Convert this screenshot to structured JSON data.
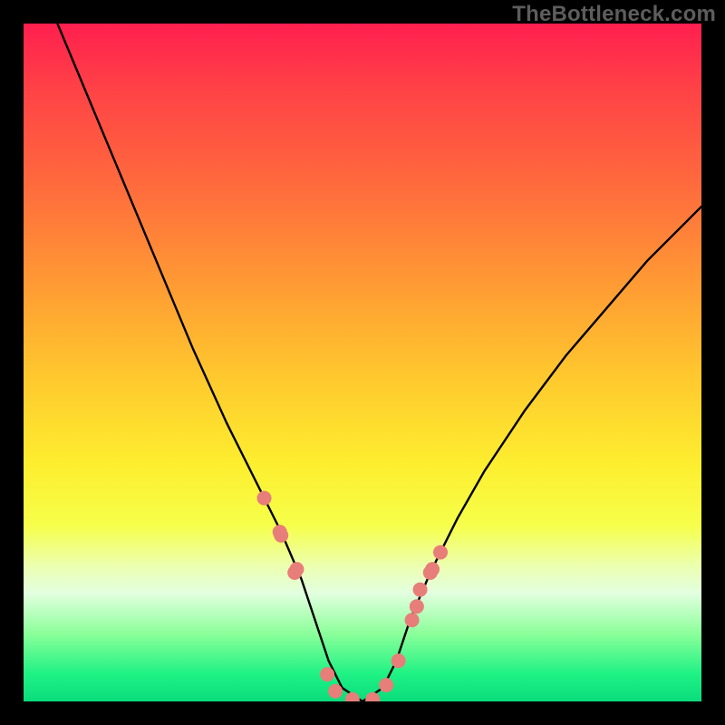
{
  "watermark": "TheBottleneck.com",
  "chart_data": {
    "type": "line",
    "title": "",
    "xlabel": "",
    "ylabel": "",
    "xlim": [
      0,
      100
    ],
    "ylim": [
      0,
      100
    ],
    "series": [
      {
        "name": "curve",
        "x": [
          5,
          10,
          15,
          20,
          25,
          30,
          35,
          38,
          41,
          43,
          45,
          47,
          50,
          53,
          55,
          57,
          60,
          64,
          68,
          74,
          80,
          86,
          92,
          98,
          100
        ],
        "y": [
          100,
          88,
          76,
          64,
          52,
          41,
          31,
          25,
          18,
          12,
          6,
          2,
          0,
          2,
          6,
          12,
          19,
          27,
          34,
          43,
          51,
          58,
          65,
          71,
          73
        ]
      }
    ],
    "markers": {
      "name": "dots",
      "x": [
        35.5,
        37.8,
        38.0,
        40.0,
        40.3,
        44.8,
        46.0,
        48.5,
        51.5,
        53.5,
        55.3,
        57.3,
        58.0,
        58.5,
        60.0,
        60.3,
        61.5
      ],
      "y": [
        30.0,
        25.0,
        24.5,
        19.0,
        19.5,
        4.0,
        1.5,
        0.3,
        0.3,
        2.4,
        6.0,
        12.0,
        14.0,
        16.5,
        19.0,
        19.5,
        22.0
      ],
      "color": "#e77e79"
    },
    "curve_color": "#000000",
    "background": "rainbow-gradient"
  }
}
